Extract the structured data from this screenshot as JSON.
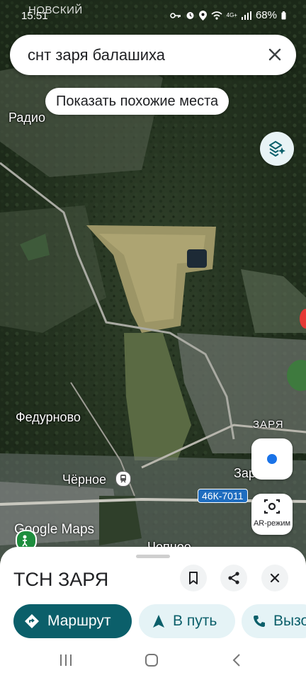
{
  "status_bar": {
    "time": "15:51",
    "battery": "68%",
    "network_label": "4G+",
    "overlay_text": "НОВСКИЙ"
  },
  "search": {
    "query": "снт заря балашиха"
  },
  "chip": {
    "label": "Показать похожие места"
  },
  "map": {
    "labels": {
      "radio": "Радио",
      "fedurnovo": "Федурново",
      "zarya": "ЗАРЯ",
      "zar": "Зар",
      "chernoe": "Чёрное",
      "chernoe_bottom": "Чепное"
    },
    "road_sign": "46К-7011",
    "watermark": "Google Maps",
    "ar_label": "AR-режим"
  },
  "place": {
    "title": "ТСН ЗАРЯ",
    "buttons": {
      "route": "Маршрут",
      "go": "В путь",
      "call": "Вызо"
    }
  },
  "colors": {
    "primary": "#0b5f6a",
    "chip_bg": "#e5f3f6",
    "accent_text": "#0b5f6a"
  }
}
